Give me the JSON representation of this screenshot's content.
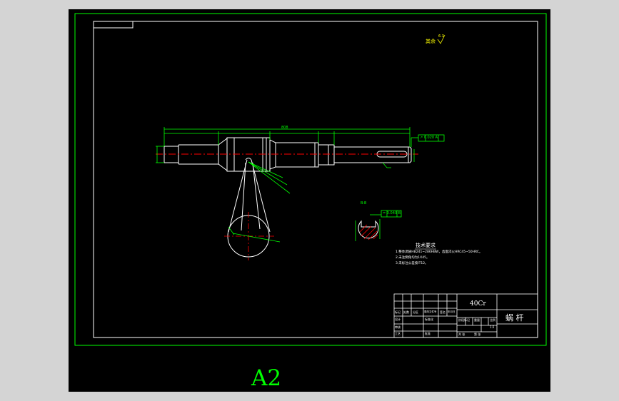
{
  "sheet": {
    "size_label": "A2"
  },
  "drawing": {
    "material": "40Cr",
    "part_name": "蜗 杆",
    "roughness_note": "其余",
    "roughness_value": "6.3",
    "overall_length": "808",
    "section_label": "B-B",
    "tech_req_title": "技术要求",
    "tech_req_lines": [
      "1.整体调质HB241~286HBW，齿面淬火HRC45~50HRC。",
      "2.未注倒角均为1X45。",
      "3.未标注公差按IT12。"
    ],
    "tolerance_frame_1": "↗ 0.020 A",
    "tolerance_frame_2": "= 0.040 B",
    "scale": "1:2",
    "title_block_labels": [
      "标记",
      "处数",
      "分区",
      "更改文件号",
      "签名",
      "年月日",
      "设计",
      "标准化",
      "阶段标记",
      "重量",
      "比例",
      "审核",
      "工艺",
      "批准",
      "共 张",
      "第 张"
    ]
  },
  "colors": {
    "background": "#000000",
    "frame": "#00ff00",
    "outline": "#ffffff",
    "centerline": "#ff0000",
    "hatch": "#ff0000",
    "text_yellow": "#ffff00"
  }
}
